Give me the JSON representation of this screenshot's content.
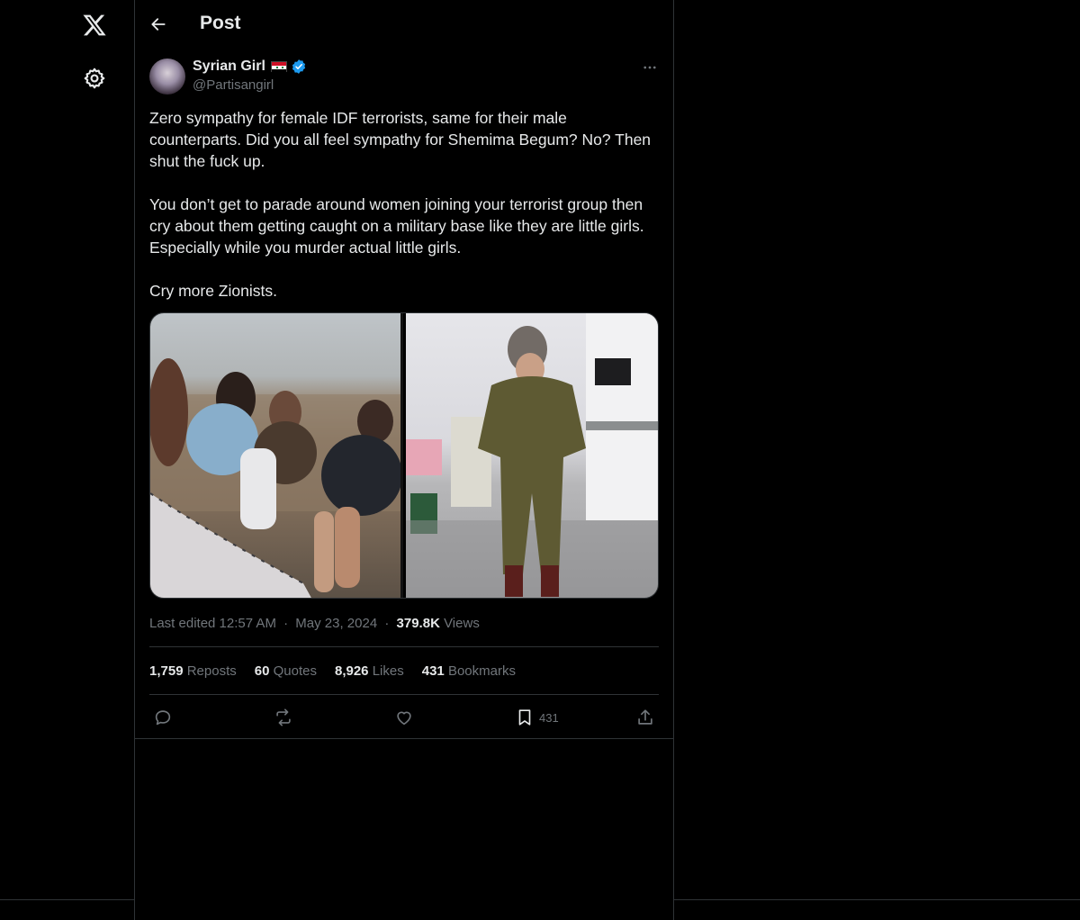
{
  "header": {
    "title": "Post"
  },
  "author": {
    "display_name": "Syrian Girl",
    "handle": "@Partisangirl"
  },
  "post": {
    "text": "Zero sympathy for female IDF terrorists, same for their male counterparts. Did you all feel sympathy for Shemima Begum? No? Then shut the fuck up.\n\nYou don’t get to parade around women joining your terrorist group then cry about them getting caught on a military base like they are little girls. Especially while you murder actual little girls.\n\nCry more Zionists."
  },
  "meta": {
    "edited": "Last edited 12:57 AM",
    "sep": "·",
    "date": "May 23, 2024",
    "views_count": "379.8K",
    "views_label": "Views"
  },
  "stats": {
    "reposts_count": "1,759",
    "reposts_label": "Reposts",
    "quotes_count": "60",
    "quotes_label": "Quotes",
    "likes_count": "8,926",
    "likes_label": "Likes",
    "bookmarks_count": "431",
    "bookmarks_label": "Bookmarks"
  },
  "actions": {
    "bookmark_count": "431"
  },
  "icons": [
    "x-logo-icon",
    "gear-icon",
    "back-arrow-icon",
    "verified-badge-icon",
    "more-icon",
    "reply-icon",
    "repost-icon",
    "like-icon",
    "bookmark-icon",
    "share-icon"
  ],
  "colors": {
    "background": "#000000",
    "text": "#e7e9ea",
    "muted": "#71767b",
    "border": "#2f3336",
    "verified": "#1d9bf0"
  }
}
